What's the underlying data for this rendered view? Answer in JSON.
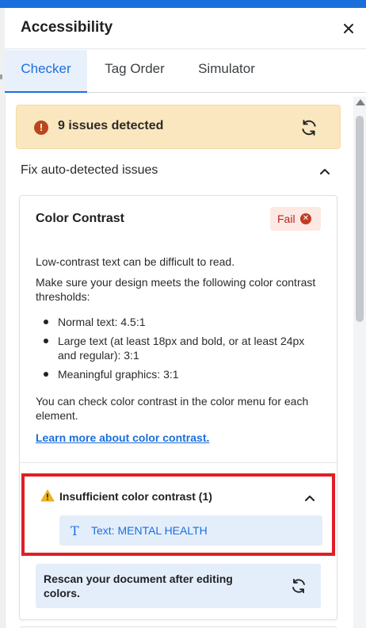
{
  "panel": {
    "title": "Accessibility",
    "close_icon": "close-icon"
  },
  "tabs": [
    {
      "label": "Checker",
      "active": true
    },
    {
      "label": "Tag Order",
      "active": false
    },
    {
      "label": "Simulator",
      "active": false
    }
  ],
  "issues_banner": {
    "icon": "exclamation-icon",
    "text": "9 issues detected",
    "refresh_icon": "refresh-icon"
  },
  "fix_section": {
    "label": "Fix auto-detected issues",
    "expanded": true
  },
  "color_contrast_card": {
    "title": "Color Contrast",
    "status": "Fail",
    "intro": "Low-contrast text can be difficult to read.",
    "thresholds_intro": "Make sure your design meets the following color contrast thresholds:",
    "thresholds": [
      "Normal text: 4.5:1",
      "Large text (at least 18px and bold, or at least 24px and regular): 3:1",
      "Meaningful graphics: 3:1"
    ],
    "how_to": "You can check color contrast in the color menu for each element.",
    "learn_more": "Learn more about color contrast."
  },
  "insufficient_group": {
    "title": "Insufficient color contrast (1)",
    "items": [
      {
        "icon": "text-type-icon",
        "label": "Text: MENTAL HEALTH"
      }
    ]
  },
  "rescan": {
    "message": "Rescan your document after editing colors.",
    "icon": "refresh-icon"
  },
  "colors": {
    "accent": "#1b6fdc",
    "warning_bg": "#fbe7bf",
    "fail_bg": "#fde8e4",
    "fail_text": "#b3261e",
    "highlight_border": "#e01e26"
  }
}
